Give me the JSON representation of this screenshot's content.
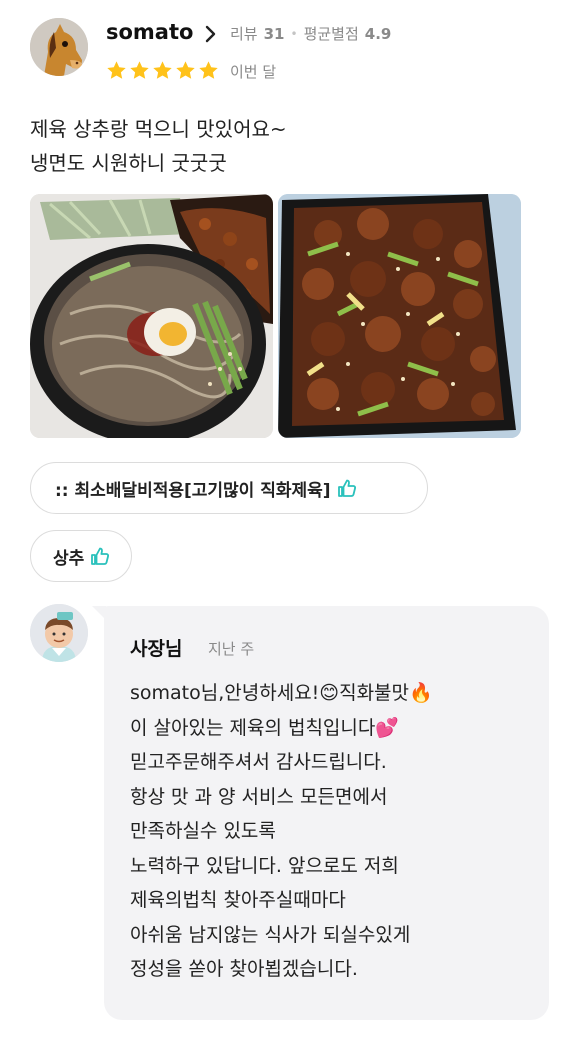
{
  "review": {
    "username": "somato",
    "review_count_label": "리뷰",
    "review_count": "31",
    "avg_rating_label": "평균별점",
    "avg_rating": "4.9",
    "rating_stars": 5,
    "date": "이번 달",
    "text_lines": [
      "제육 상추랑 먹으니 맛있어요~",
      "냉면도 시원하니 굿굿굿"
    ],
    "photos": [
      "cold-noodles-and-spicy-pork",
      "spicy-pork-bulgogi"
    ]
  },
  "menu_tags": [
    {
      "label": ":: 최소배달비적용[고기많이 직화제육]",
      "icon": "thumbs-up-icon"
    },
    {
      "label": "상추",
      "icon": "thumbs-up-icon"
    }
  ],
  "owner_reply": {
    "name": "사장님",
    "date": "지난 주",
    "lines": [
      "somato님,안녕하세요!😊직화불맛🔥",
      "이 살아있는 제육의 법칙입니다💕",
      "믿고주문해주셔서 감사드립니다.",
      "항상 맛 과 양 서비스 모든면에서",
      "만족하실수 있도록",
      "노력하구 있답니다. 앞으로도  저희",
      "제육의법칙 찾아주실때마다",
      "아쉬움 남지않는 식사가 되실수있게",
      "정성을 쏟아 찾아뵙겠습니다."
    ]
  },
  "colors": {
    "star": "#ffc21a",
    "thumb": "#2ac1bc",
    "reply_bg": "#f3f3f5",
    "muted": "#8a8a8a"
  }
}
